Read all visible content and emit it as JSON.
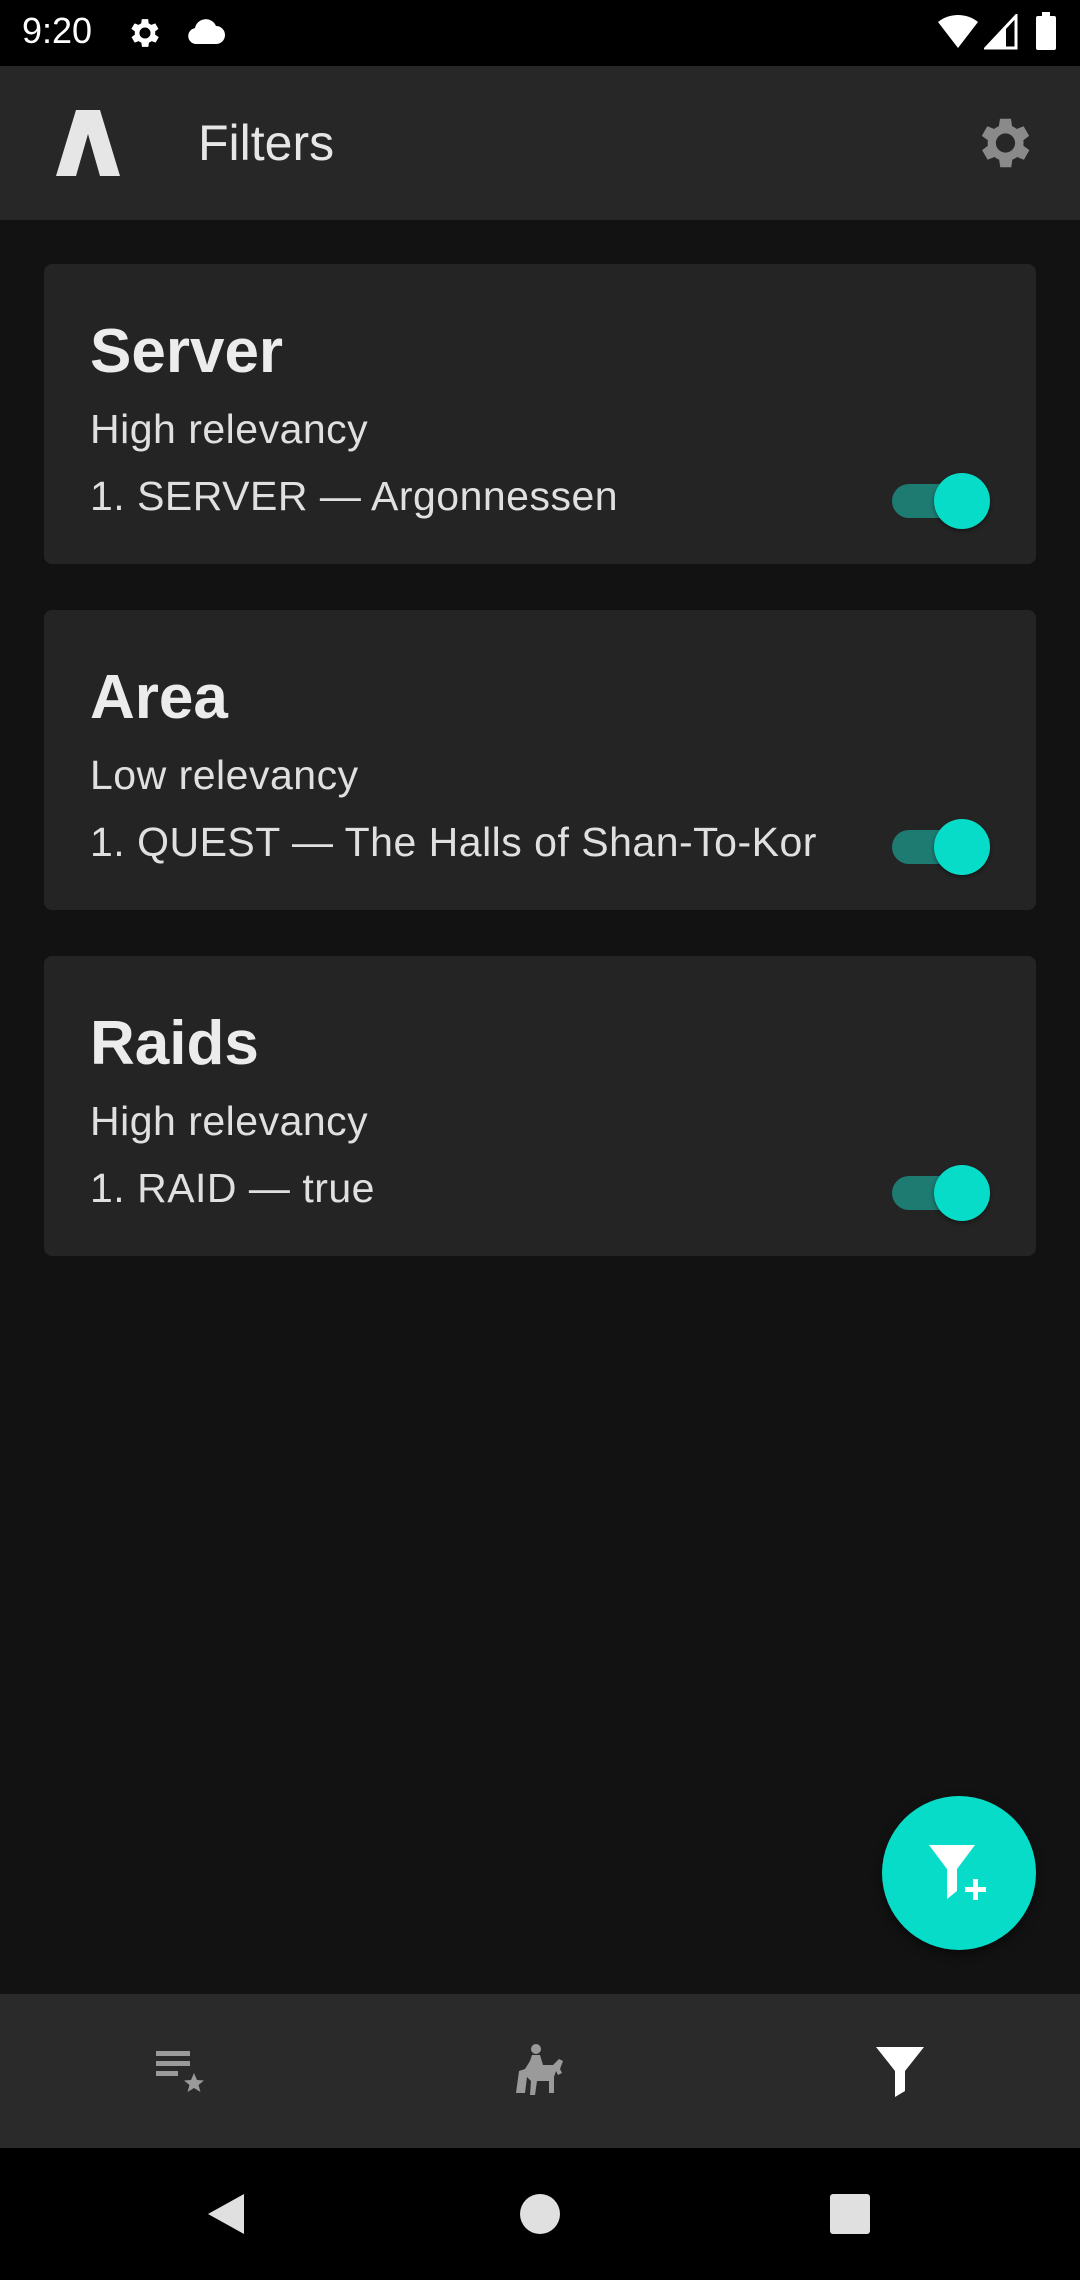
{
  "status_bar": {
    "time": "9:20",
    "icons": [
      "gear-icon",
      "cloud-icon",
      "wifi-icon",
      "cell-signal-icon",
      "battery-icon"
    ]
  },
  "app_bar": {
    "title": "Filters",
    "logo_icon": "app-logo-icon",
    "settings_icon": "gear-icon"
  },
  "cards": [
    {
      "title": "Server",
      "relevancy": "High relevancy",
      "rule": "1. SERVER — Argonnessen",
      "enabled": true
    },
    {
      "title": "Area",
      "relevancy": "Low relevancy",
      "rule": "1. QUEST — The Halls of Shan-To-Kor",
      "enabled": true
    },
    {
      "title": "Raids",
      "relevancy": "High relevancy",
      "rule": "1. RAID — true",
      "enabled": true
    }
  ],
  "fab": {
    "icon": "filter-add-icon"
  },
  "bottom_nav": {
    "items": [
      {
        "icon": "favorite-list-icon",
        "selected": false
      },
      {
        "icon": "knight-horse-icon",
        "selected": false
      },
      {
        "icon": "filter-icon",
        "selected": true
      }
    ]
  },
  "system_nav": {
    "icons": [
      "back-icon",
      "home-icon",
      "recents-icon"
    ]
  },
  "colors": {
    "accent": "#07dcc8",
    "toggle_track": "#1d7b72",
    "background": "#121212",
    "card": "#242424",
    "app_bar": "#272727"
  }
}
